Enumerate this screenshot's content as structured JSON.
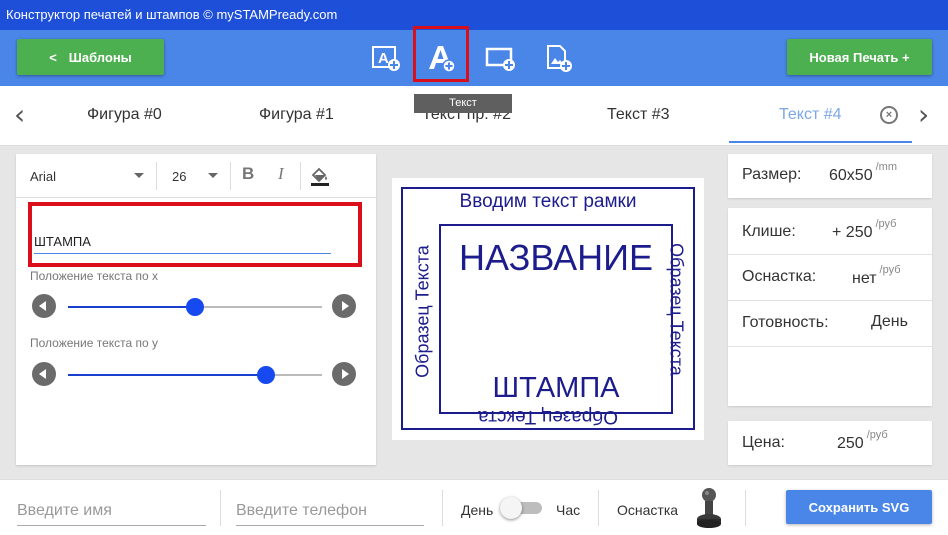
{
  "window": {
    "title": "Конструктор печатей и штампов © mySTAMPready.com"
  },
  "toolbar": {
    "templates_chevron": "<",
    "templates_label": "Шаблоны",
    "new_stamp_label": "Новая Печать +",
    "tool_icons": [
      "add-shape-icon",
      "add-text-icon",
      "add-frame-icon",
      "add-image-icon"
    ],
    "selected_tool": "add-text-icon",
    "tooltip": "Текст"
  },
  "tabs": {
    "prev": "‹",
    "next": "›",
    "items": [
      {
        "label": "Фигура #0"
      },
      {
        "label": "Фигура #1"
      },
      {
        "label": "Текст пр. #2"
      },
      {
        "label": "Текст #3"
      },
      {
        "label": "Текст #4"
      }
    ],
    "active_index": 4
  },
  "editor": {
    "font": "Arial",
    "font_size": "26",
    "bold": "B",
    "italic": "I",
    "text_value": "ШТАМПА",
    "position_x_label": "Положение текста по x",
    "position_x_value": 0.5,
    "position_y_label": "Положение текста по y",
    "position_y_value": 0.78
  },
  "stamp": {
    "top_text": "Вводим текст рамки",
    "name": "НАЗВАНИЕ",
    "main_text": "ШТАМПА",
    "side_left": "Образец Текста",
    "side_right": "Образец Текста",
    "bottom_text": "Образец Текста",
    "ink_color": "#1c1c8c"
  },
  "pricing": {
    "size_label": "Размер:",
    "size_value": "60x50",
    "size_unit": "/mm",
    "cliche_label": "Клише:",
    "cliche_value": "+ 250",
    "cliche_unit": "/руб",
    "mount_label": "Оснастка:",
    "mount_value": "нет",
    "mount_unit": "/руб",
    "ready_label": "Готовность:",
    "ready_value": "День",
    "price_label": "Цена:",
    "price_value": "250",
    "price_unit": "/руб"
  },
  "bottom": {
    "name_placeholder": "Введите имя",
    "phone_placeholder": "Введите телефон",
    "day_label": "День",
    "hour_label": "Час",
    "mount_label": "Оснастка",
    "save_label": "Сохранить SVG"
  },
  "colors": {
    "titlebar": "#1e4fd8",
    "toolbar": "#4a86e8",
    "green": "#4caf50",
    "highlight": "#d9101b",
    "slider": "#1649f0"
  }
}
